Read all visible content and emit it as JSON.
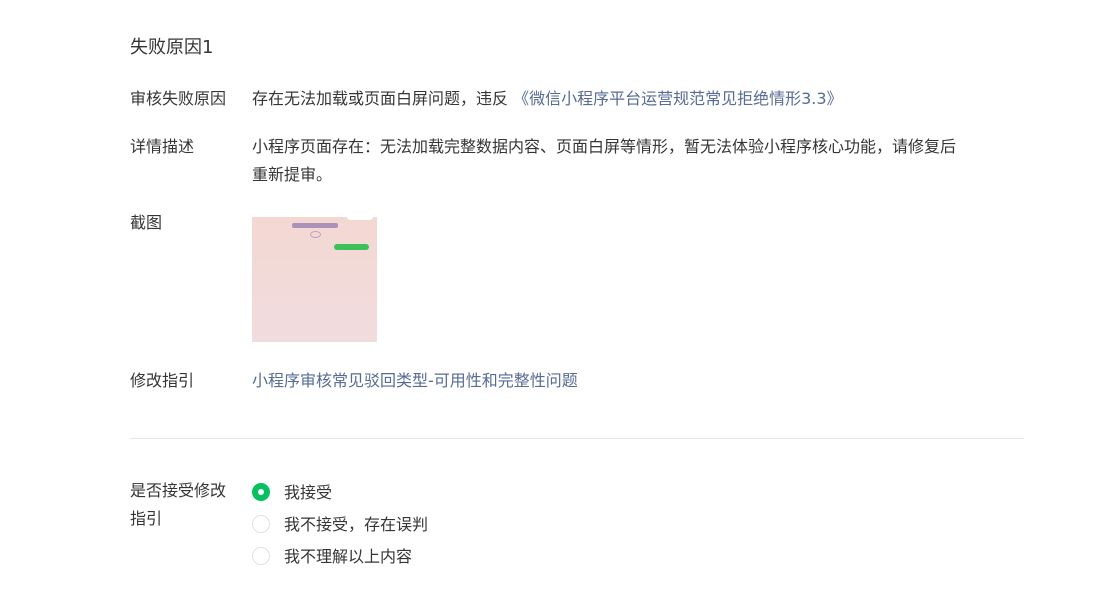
{
  "section_title": "失败原因1",
  "reason": {
    "label": "审核失败原因",
    "text": "存在无法加载或页面白屏问题，违反",
    "link": "《微信小程序平台运营规范常见拒绝情形3.3》"
  },
  "detail": {
    "label": "详情描述",
    "text_line1": "小程序页面存在：无法加载完整数据内容、页面白屏等情形，暂无法体验小程序核心功能，请修复后",
    "text_line2": "重新提审。"
  },
  "screenshot": {
    "label": "截图"
  },
  "guide": {
    "label": "修改指引",
    "link": "小程序审核常见驳回类型-可用性和完整性问题"
  },
  "accept": {
    "label_line1": "是否接受修改",
    "label_line2": "指引",
    "options": [
      {
        "label": "我接受",
        "checked": true
      },
      {
        "label": "我不接受，存在误判",
        "checked": false
      },
      {
        "label": "我不理解以上内容",
        "checked": false
      }
    ]
  },
  "colors": {
    "text": "#353535",
    "link": "#576b95",
    "radio_checked": "#07c160",
    "divider": "#e7e7e7"
  }
}
